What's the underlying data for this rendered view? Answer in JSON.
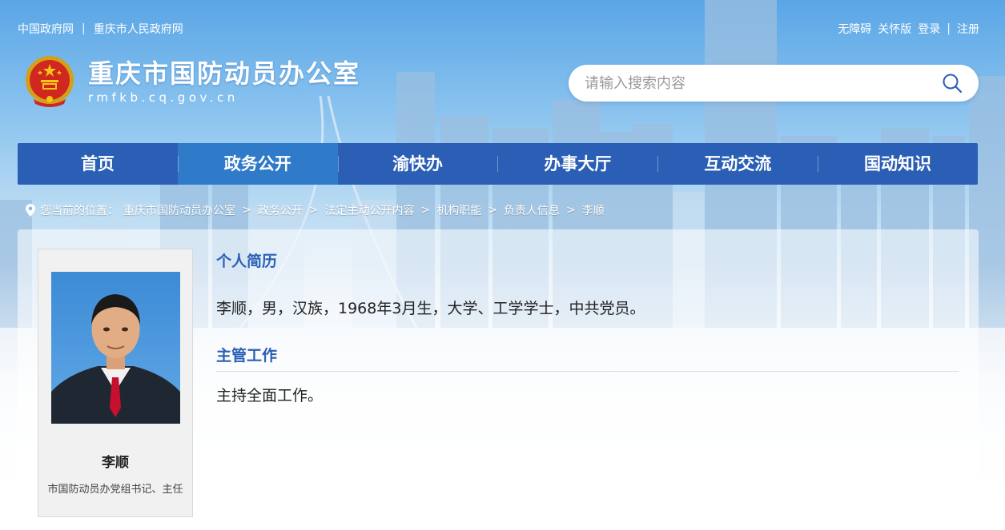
{
  "topbar": {
    "left_links": [
      "中国政府网",
      "重庆市人民政府网"
    ],
    "separator": "|",
    "right_links": [
      "无障碍",
      "关怀版",
      "登录"
    ],
    "right_separator": "|",
    "register": "注册"
  },
  "header": {
    "site_name": "重庆市国防动员办公室",
    "domain": "rmfkb.cq.gov.cn"
  },
  "search": {
    "placeholder": "请输入搜索内容"
  },
  "nav": {
    "items": [
      "首页",
      "政务公开",
      "渝快办",
      "办事大厅",
      "互动交流",
      "国动知识"
    ],
    "active": "政务公开"
  },
  "breadcrumb": {
    "prefix": "您当前的位置：",
    "items": [
      "重庆市国防动员办公室",
      "政务公开",
      "法定主动公开内容",
      "机构职能",
      "负责人信息",
      "李顺"
    ],
    "arrow": ">"
  },
  "profile": {
    "name": "李顺",
    "position": "市国防动员办党组书记、主任"
  },
  "sections": {
    "resume_title": "个人简历",
    "resume_text": "李顺，男，汉族，1968年3月生，大学、工学学士，中共党员。",
    "work_title": "主管工作",
    "work_text": "主持全面工作。"
  },
  "colors": {
    "nav_bg": "#2a5fb5",
    "nav_active": "#2f7ac9",
    "section_title": "#2a5fb5"
  }
}
